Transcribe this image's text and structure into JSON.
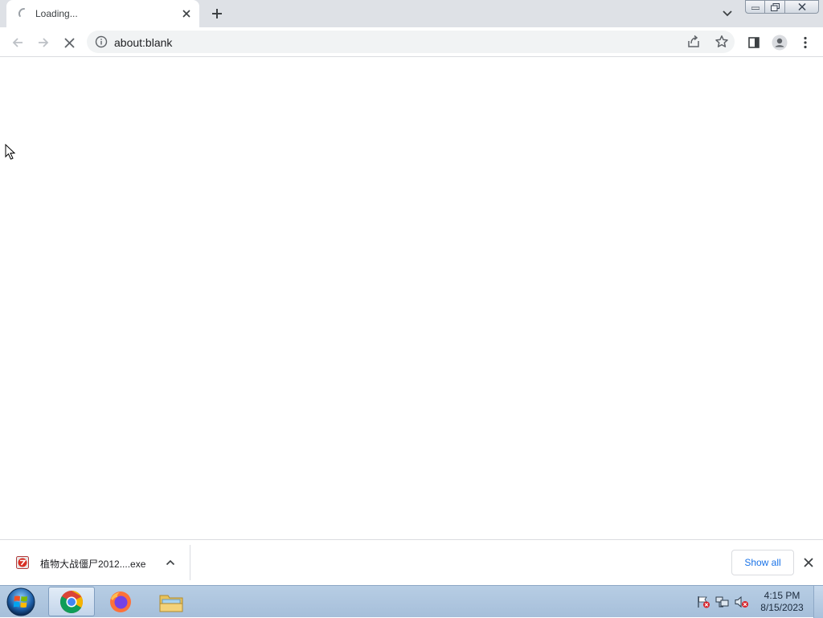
{
  "tab": {
    "title": "Loading...",
    "close_icon": "close-icon",
    "spinner_icon": "loading-spinner-icon"
  },
  "tabstrip": {
    "new_tab_icon": "plus-icon",
    "tab_search_icon": "chevron-down-icon"
  },
  "window_controls": {
    "minimize_icon": "minimize-icon",
    "maximize_icon": "restore-icon",
    "close_icon": "close-icon"
  },
  "toolbar": {
    "back_icon": "arrow-left-icon",
    "forward_icon": "arrow-right-icon",
    "stop_icon": "close-icon",
    "url": "about:blank",
    "info_icon": "info-icon",
    "share_icon": "share-icon",
    "bookmark_icon": "star-icon",
    "side_panel_icon": "side-panel-icon",
    "profile_icon": "avatar-icon",
    "menu_icon": "kebab-menu-icon"
  },
  "download_shelf": {
    "items": [
      {
        "filename": "植物大战僵尸2012....exe",
        "icon": "installer-file-icon"
      }
    ],
    "show_all_label": "Show all",
    "close_icon": "close-icon"
  },
  "taskbar": {
    "start_icon": "windows-start-icon",
    "apps": [
      {
        "name": "Google Chrome",
        "icon": "chrome-icon",
        "active": true
      },
      {
        "name": "Firefox",
        "icon": "firefox-icon",
        "active": false
      },
      {
        "name": "Windows Explorer",
        "icon": "folder-icon",
        "active": false
      }
    ],
    "tray": {
      "icons": [
        "action-center-flag-icon",
        "network-icon",
        "volume-muted-icon"
      ],
      "time": "4:15 PM",
      "date": "8/15/2023"
    }
  },
  "colors": {
    "tabstrip_bg": "#dee1e6",
    "omnibox_bg": "#f1f3f4",
    "accent": "#1a73e8",
    "taskbar_bg": "#b7cde4"
  }
}
